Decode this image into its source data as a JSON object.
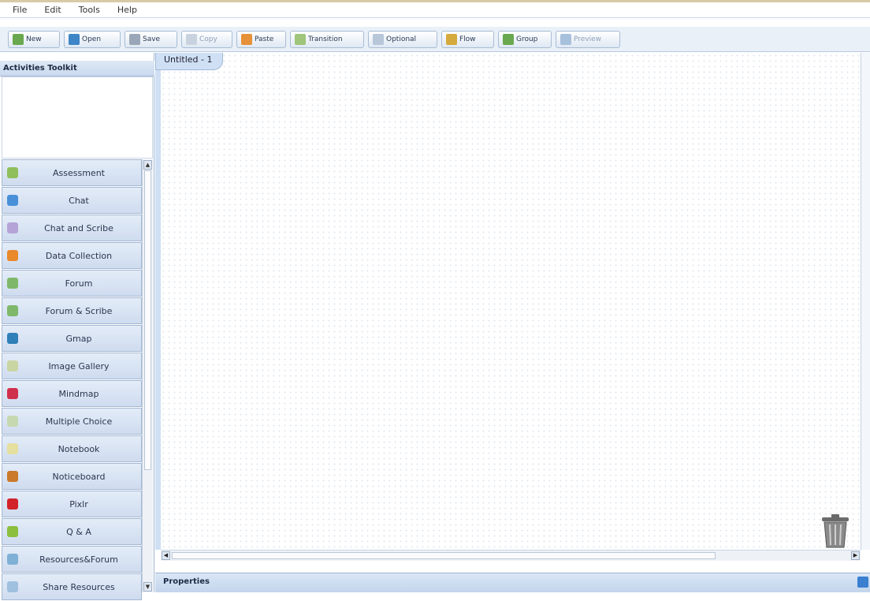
{
  "menu": [
    "File",
    "Edit",
    "Tools",
    "Help"
  ],
  "toolbar": [
    {
      "label": "New",
      "icon": "new-icon",
      "color": "#6aa84f",
      "disabled": false
    },
    {
      "label": "Open",
      "icon": "open-icon",
      "color": "#3d85c6",
      "disabled": false
    },
    {
      "label": "Save",
      "icon": "save-icon",
      "color": "#9aa7b8",
      "disabled": false
    },
    {
      "label": "Copy",
      "icon": "copy-icon",
      "color": "#c9d3df",
      "disabled": true
    },
    {
      "label": "Paste",
      "icon": "paste-icon",
      "color": "#e69138",
      "disabled": false
    },
    {
      "label": "Transition",
      "icon": "transition-icon",
      "color": "#9fc57a",
      "disabled": false
    },
    {
      "label": "Optional",
      "icon": "optional-icon",
      "color": "#b7c6d8",
      "disabled": false
    },
    {
      "label": "Flow",
      "icon": "flow-icon",
      "color": "#d5a93b",
      "disabled": false
    },
    {
      "label": "Group",
      "icon": "group-icon",
      "color": "#6aa84f",
      "disabled": false
    },
    {
      "label": "Preview",
      "icon": "preview-icon",
      "color": "#a7c0dc",
      "disabled": true
    }
  ],
  "panel": {
    "title": "Activities Toolkit"
  },
  "tools": [
    {
      "label": "Assessment",
      "icon": "assessment-icon",
      "color": "#8fbf5a"
    },
    {
      "label": "Chat",
      "icon": "chat-icon",
      "color": "#4a90d9"
    },
    {
      "label": "Chat and Scribe",
      "icon": "chat-scribe-icon",
      "color": "#b4a3d6"
    },
    {
      "label": "Data Collection",
      "icon": "data-collection-icon",
      "color": "#e8892b"
    },
    {
      "label": "Forum",
      "icon": "forum-icon",
      "color": "#7fb86a"
    },
    {
      "label": "Forum & Scribe",
      "icon": "forum-scribe-icon",
      "color": "#7fb86a"
    },
    {
      "label": "Gmap",
      "icon": "globe-icon",
      "color": "#2f7fb8"
    },
    {
      "label": "Image Gallery",
      "icon": "image-gallery-icon",
      "color": "#c9d6a3"
    },
    {
      "label": "Mindmap",
      "icon": "mindmap-icon",
      "color": "#d0304c"
    },
    {
      "label": "Multiple Choice",
      "icon": "multiple-choice-icon",
      "color": "#c6d8b0"
    },
    {
      "label": "Notebook",
      "icon": "notebook-icon",
      "color": "#e5dfa0"
    },
    {
      "label": "Noticeboard",
      "icon": "noticeboard-icon",
      "color": "#c97a2a"
    },
    {
      "label": "Pixlr",
      "icon": "pixlr-icon",
      "color": "#d3232a"
    },
    {
      "label": "Q & A",
      "icon": "qa-icon",
      "color": "#8bbf3d"
    },
    {
      "label": "Resources&Forum",
      "icon": "resources-forum-icon",
      "color": "#7fb0d6"
    },
    {
      "label": "Share Resources",
      "icon": "share-resources-icon",
      "color": "#9fc0de"
    }
  ],
  "canvas": {
    "tab_title": "Untitled - 1"
  },
  "properties": {
    "title": "Properties"
  }
}
